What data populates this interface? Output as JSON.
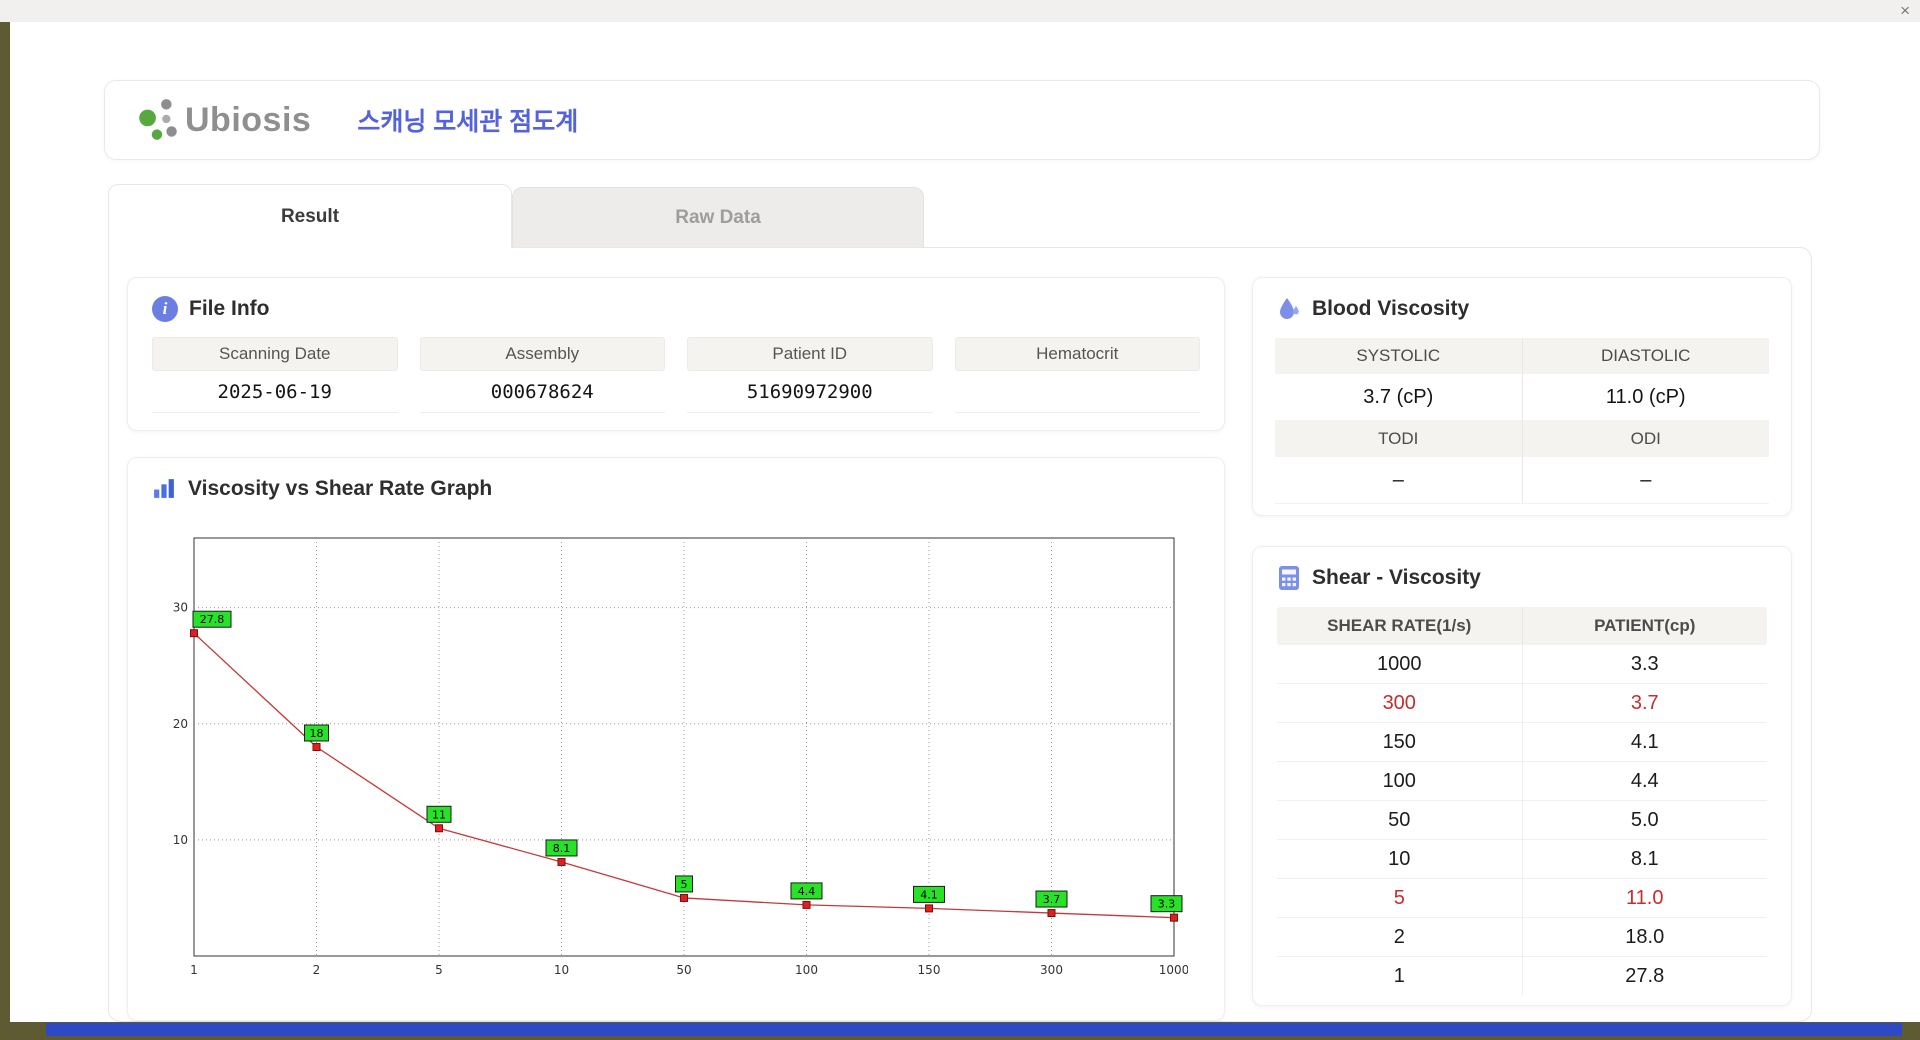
{
  "window": {
    "close_label": "×"
  },
  "header": {
    "logo_text": "Ubiosis",
    "title": "스캐닝 모세관 점도계"
  },
  "tabs": [
    {
      "label": "Result",
      "active": true
    },
    {
      "label": "Raw Data",
      "active": false
    }
  ],
  "file_info": {
    "title": "File Info",
    "fields": [
      {
        "label": "Scanning Date",
        "value": "2025-06-19"
      },
      {
        "label": "Assembly",
        "value": "000678624"
      },
      {
        "label": "Patient ID",
        "value": "51690972900"
      },
      {
        "label": "Hematocrit",
        "value": ""
      }
    ]
  },
  "graph": {
    "title": "Viscosity vs Shear Rate Graph"
  },
  "blood_viscosity": {
    "title": "Blood Viscosity",
    "systolic_label": "SYSTOLIC",
    "systolic_value": "3.7 (cP)",
    "diastolic_label": "DIASTOLIC",
    "diastolic_value": "11.0 (cP)",
    "todi_label": "TODI",
    "todi_value": "–",
    "odi_label": "ODI",
    "odi_value": "–"
  },
  "shear_table": {
    "title": "Shear - Viscosity",
    "columns": [
      "SHEAR RATE(1/s)",
      "PATIENT(cp)"
    ],
    "rows": [
      {
        "rate": "1000",
        "patient": "3.3",
        "highlight": false
      },
      {
        "rate": "300",
        "patient": "3.7",
        "highlight": true
      },
      {
        "rate": "150",
        "patient": "4.1",
        "highlight": false
      },
      {
        "rate": "100",
        "patient": "4.4",
        "highlight": false
      },
      {
        "rate": "50",
        "patient": "5.0",
        "highlight": false
      },
      {
        "rate": "10",
        "patient": "8.1",
        "highlight": false
      },
      {
        "rate": "5",
        "patient": "11.0",
        "highlight": true
      },
      {
        "rate": "2",
        "patient": "18.0",
        "highlight": false
      },
      {
        "rate": "1",
        "patient": "27.8",
        "highlight": false
      }
    ]
  },
  "chart_data": {
    "type": "line",
    "title": "Viscosity vs Shear Rate Graph",
    "x_axis_type": "categorical-log",
    "x_labels": [
      "1",
      "2",
      "5",
      "10",
      "50",
      "100",
      "150",
      "300",
      "1000"
    ],
    "series": [
      {
        "name": "Patient",
        "values": [
          27.8,
          18,
          11,
          8.1,
          5,
          4.4,
          4.1,
          3.7,
          3.3
        ]
      }
    ],
    "point_labels": [
      "27.8",
      "18",
      "11",
      "8.1",
      "5",
      "4.4",
      "4.1",
      "3.7",
      "3.3"
    ],
    "xlabel": "",
    "ylabel": "",
    "y_ticks": [
      10,
      20,
      30
    ],
    "ylim": [
      0,
      36
    ],
    "grid": "dotted",
    "legend": "none",
    "colors": {
      "line": "#c23b3b",
      "marker": "#e02020",
      "marker_border": "#7a0f0f",
      "point_label_bg": "#27e227",
      "point_label_border": "#1a1a1a"
    }
  },
  "colors": {
    "accent_blue": "#5563d8",
    "highlight_red": "#c22f2f",
    "header_cell_bg": "#f5f3f0",
    "chrome_olive": "#5e5b33",
    "chrome_blue": "#2e49c5"
  }
}
